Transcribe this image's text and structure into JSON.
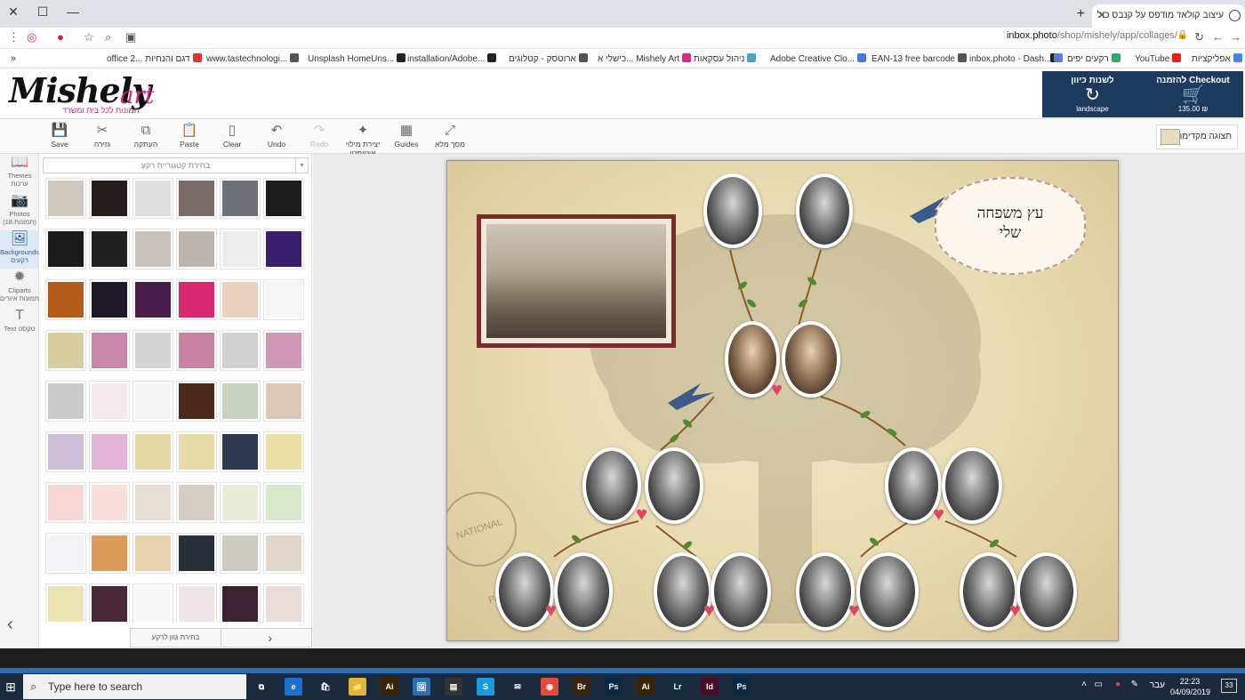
{
  "browser": {
    "tab_title": "עיצוב קולאז' מודפס על קנבס כול",
    "url_domain": "inbox.photo",
    "url_path": "/shop/mishely/app/collages/",
    "bookmarks": [
      {
        "label": "אפליקציות",
        "color": "#4285f4"
      },
      {
        "label": "YouTube",
        "color": "#e62117"
      },
      {
        "label": "רקעים יפים",
        "color": "#3aa36a"
      },
      {
        "label": "",
        "color": "#222"
      },
      {
        "label": "inbox.photo - Dash...",
        "color": "#5b7bd5"
      },
      {
        "label": "EAN-13 free barcode",
        "color": "#555"
      },
      {
        "label": "Adobe Creative Clo...",
        "color": "#4a7bd4"
      },
      {
        "label": "ניהול עסקאות",
        "color": "#4e9fd4"
      },
      {
        "label": "כישלי א... Mishely Art",
        "color": "#d42e80"
      },
      {
        "label": "ארוטסק - קטלוגים",
        "color": "#555"
      },
      {
        "label": "installation/Adobe...",
        "color": "#222"
      },
      {
        "label": "Unsplash HomeUns...",
        "color": "#222"
      },
      {
        "label": "www.tastechnologi...",
        "color": "#555"
      },
      {
        "label": "office 2... דגם והנחיות",
        "color": "#d33"
      }
    ]
  },
  "header": {
    "logo_main": "Mishely",
    "logo_accent": "art",
    "logo_tagline": "תמונות לכל בית ומשרד",
    "checkout": {
      "label": "להזמנה Checkout",
      "price": "135.00 ₪"
    },
    "orientation": {
      "label": "לשנות כיוון",
      "sub": "landscape"
    }
  },
  "toolbar": {
    "buttons": [
      {
        "label": "Save",
        "icon": "save-icon",
        "glyph": "💾",
        "disabled": false
      },
      {
        "label": "גזירה",
        "icon": "cut-icon",
        "glyph": "✂",
        "disabled": false
      },
      {
        "label": "העתקה",
        "icon": "copy-icon",
        "glyph": "⧉",
        "disabled": false
      },
      {
        "label": "Paste",
        "icon": "paste-icon",
        "glyph": "📋",
        "disabled": false
      },
      {
        "label": "Clear",
        "icon": "clear-icon",
        "glyph": "▯",
        "disabled": false
      },
      {
        "label": "Undo",
        "icon": "undo-icon",
        "glyph": "↶",
        "disabled": false
      },
      {
        "label": "Redo",
        "icon": "redo-icon",
        "glyph": "↷",
        "disabled": true
      },
      {
        "label": "יצירת מילוי אוטומטי",
        "icon": "magic-wand-icon",
        "glyph": "✦",
        "disabled": false
      },
      {
        "label": "Guides",
        "icon": "grid-icon",
        "glyph": "▦",
        "disabled": false
      },
      {
        "label": "מסך מלא",
        "icon": "fullscreen-icon",
        "glyph": "⤢",
        "disabled": false
      }
    ],
    "preview_label": "תצוגה מקדימה"
  },
  "leftnav": [
    {
      "label": "Themes ערכות",
      "icon": "book-icon",
      "glyph": "📖",
      "active": false
    },
    {
      "label": "Photos (תמונות 18)",
      "icon": "camera-icon",
      "glyph": "📷",
      "active": false
    },
    {
      "label": "Backgrounds רקעים",
      "icon": "image-icon",
      "glyph": "🖼",
      "active": true
    },
    {
      "label": "Cliparts תמונות איורים",
      "icon": "clipart-icon",
      "glyph": "✹",
      "active": false
    },
    {
      "label": "Text טקסט",
      "icon": "text-icon",
      "glyph": "T",
      "active": false
    }
  ],
  "panel": {
    "category_placeholder": "בחירת קטגוריית רקע",
    "footer_label": "בחירת גוון לרקע",
    "swatches": [
      "#cfc8bd",
      "#241b1b",
      "#dedede",
      "#7d6c6c",
      "#6f7178",
      "#1c1c1c",
      "#1a1a1a",
      "#202020",
      "#c9c1bc",
      "#bdb6b0",
      "#ececec",
      "#3b1f6d",
      "#b45a1a",
      "#1e1a2a",
      "#4a1e4a",
      "#d9286e",
      "#e9d3c0",
      "#f6f6f6",
      "#d8cda0",
      "#c889a8",
      "#d4d4d4",
      "#c783a1",
      "#d1d1d1",
      "#cf97b4",
      "#cbcbcb",
      "#f3e9ec",
      "#f4f4f4",
      "#4a2a1d",
      "#c7d2bf",
      "#dcc8b8",
      "#cdbfd8",
      "#e2b3d4",
      "#e4d9a6",
      "#e5dba8",
      "#2f3a52",
      "#ebdfa8",
      "#f7d7d3",
      "#f9dedb",
      "#e7ded3",
      "#d5cfc3",
      "#e8ecd7",
      "#d8e8cd",
      "#f2f4f8",
      "#dc9a5b",
      "#e9d3b0",
      "#2a2f37",
      "#cdcbc0",
      "#e0d6c9",
      "#ece3b3",
      "#4a2838",
      "#f7f7f7",
      "#efe3e6",
      "#3a2230",
      "#eadcd8"
    ]
  },
  "canvas": {
    "title_lines": [
      "עץ משפחה",
      "שלי"
    ],
    "stamp_text": "NATIONAL PARK"
  },
  "taskbar": {
    "search_placeholder": "Type here to search",
    "apps": [
      {
        "icon": "task-view-icon",
        "glyph": "⧉",
        "color": "#1b2a3d"
      },
      {
        "icon": "edge-icon",
        "glyph": "e",
        "color": "#1b6fd1"
      },
      {
        "icon": "store-icon",
        "glyph": "🛍",
        "color": "#1b2a3d"
      },
      {
        "icon": "folder-icon",
        "glyph": "📁",
        "color": "#e3b43a"
      },
      {
        "icon": "illustrator-icon",
        "glyph": "Ai",
        "color": "#3b2200"
      },
      {
        "icon": "photos-icon",
        "glyph": "🖼",
        "color": "#2b6fb6"
      },
      {
        "icon": "calculator-icon",
        "glyph": "▤",
        "color": "#333"
      },
      {
        "icon": "skype-icon",
        "glyph": "S",
        "color": "#1a9be0"
      },
      {
        "icon": "mail-icon",
        "glyph": "✉",
        "color": "#1b2a3d"
      },
      {
        "icon": "chrome-icon",
        "glyph": "◉",
        "color": "#e24b3b"
      },
      {
        "icon": "bridge-icon",
        "glyph": "Br",
        "color": "#3a2310"
      },
      {
        "icon": "photoshop-icon",
        "glyph": "Ps",
        "color": "#0b2a45"
      },
      {
        "icon": "illustrator-icon",
        "glyph": "Ai",
        "color": "#3b2200"
      },
      {
        "icon": "lightroom-icon",
        "glyph": "Lr",
        "color": "#0e2f3b"
      },
      {
        "icon": "indesign-icon",
        "glyph": "Id",
        "color": "#4a0d27"
      },
      {
        "icon": "photoshop-icon",
        "glyph": "Ps",
        "color": "#0b2a45"
      }
    ],
    "language": "עבר",
    "time": "22:23",
    "date": "04/09/2019",
    "notifications": "33"
  }
}
